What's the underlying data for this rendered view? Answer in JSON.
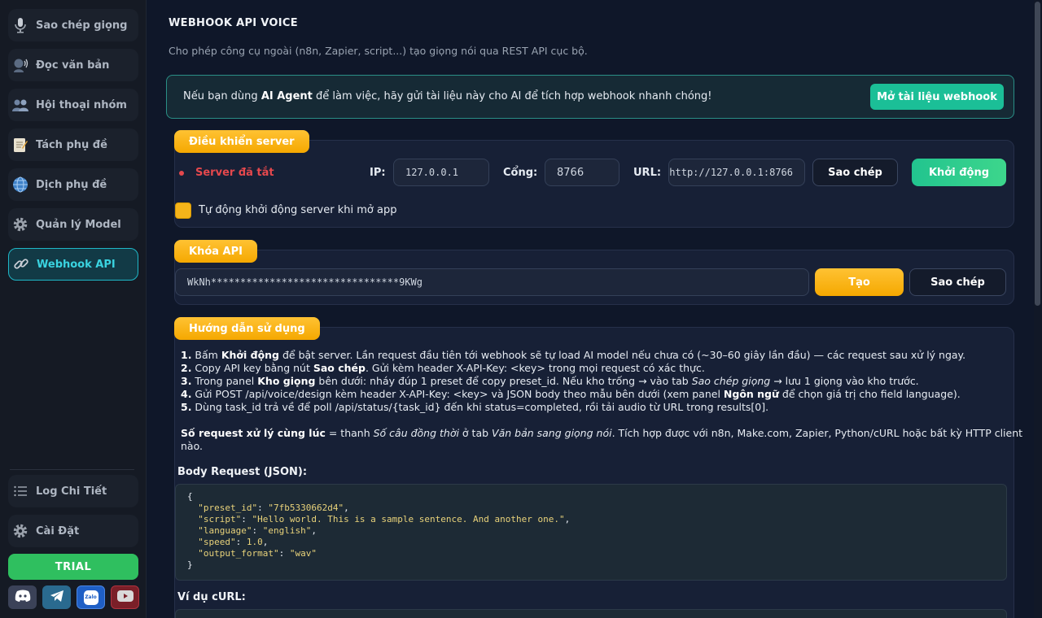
{
  "sidebar": {
    "items": [
      {
        "label": "Sao chép giọng",
        "icon": "microphone-icon"
      },
      {
        "label": "Đọc văn bản",
        "icon": "speaking-head-icon"
      },
      {
        "label": "Hội thoại nhóm",
        "icon": "people-icon"
      },
      {
        "label": "Tách phụ đề",
        "icon": "memo-icon"
      },
      {
        "label": "Dịch phụ đề",
        "icon": "globe-icon"
      },
      {
        "label": "Quản lý Model",
        "icon": "gear-icon"
      },
      {
        "label": "Webhook API",
        "icon": "link-icon",
        "active": true
      }
    ],
    "bottom": [
      {
        "label": "Log Chi Tiết",
        "icon": "list-icon"
      },
      {
        "label": "Cài Đặt",
        "icon": "gear-icon"
      }
    ],
    "trial_label": "TRIAL",
    "socials": [
      "discord-icon",
      "telegram-icon",
      "zalo-icon",
      "youtube-icon"
    ],
    "zalo_text": "Zalo"
  },
  "header": {
    "title": "WEBHOOK API VOICE",
    "subtitle": "Cho phép công cụ ngoài (n8n, Zapier, script...) tạo giọng nói qua REST API cục bộ."
  },
  "banner": {
    "text_pre": "Nếu bạn dùng ",
    "text_bold": "AI Agent",
    "text_post": " để làm việc, hãy gửi tài liệu này cho AI để tích hợp webhook nhanh chóng!",
    "button": "Mở tài liệu webhook"
  },
  "server": {
    "tag": "Điều khiển server",
    "status": "Server đã tắt",
    "ip_label": "IP:",
    "ip_value": "127.0.0.1",
    "port_label": "Cổng:",
    "port_value": "8766",
    "url_label": "URL:",
    "url_value": "http://127.0.0.1:8766",
    "copy_button": "Sao chép",
    "start_button": "Khởi động",
    "autostart_label": "Tự động khởi động server khi mở app"
  },
  "apikey": {
    "tag": "Khóa API",
    "value": "WkNh********************************9KWg",
    "generate_button": "Tạo",
    "copy_button": "Sao chép"
  },
  "guide": {
    "tag": "Hướng dẫn sử dụng",
    "steps": [
      {
        "num": "1.",
        "pre": " Bấm ",
        "bold": "Khởi động",
        "post": " để bật server. Lần request đầu tiên tới webhook sẽ tự load AI model nếu chưa có (~30–60 giây lần đầu) — các request sau xử lý ngay."
      },
      {
        "num": "2.",
        "pre": " Copy API key bằng nút ",
        "bold": "Sao chép",
        "post": ". Gửi kèm header X-API-Key: <key> trong mọi request có xác thực."
      },
      {
        "num": "3.",
        "pre": " Trong panel ",
        "bold": "Kho giọng",
        "mid": " bên dưới: nháy đúp 1 preset để copy preset_id. Nếu kho trống → vào tab ",
        "ital": "Sao chép giọng",
        "post": " → lưu 1 giọng vào kho trước."
      },
      {
        "num": "4.",
        "pre": " Gửi POST /api/voice/design kèm header X-API-Key: <key> và JSON body theo mẫu bên dưới (xem panel ",
        "bold": "Ngôn ngữ",
        "post": " để chọn giá trị cho field language)."
      },
      {
        "num": "5.",
        "pre": " Dùng task_id trả về để poll /api/status/{task_id} đến khi status=completed, rồi tải audio từ URL trong results[0].",
        "bold": "",
        "post": ""
      }
    ],
    "concurrency_bold": "Số request xử lý cùng lúc",
    "concurrency_mid1": " = thanh ",
    "concurrency_ital1": "Số câu đồng thời",
    "concurrency_mid2": " ở tab ",
    "concurrency_ital2": "Văn bản sang giọng nói",
    "concurrency_post": ". Tích hợp được với n8n, Make.com, Zapier, Python/cURL hoặc bất kỳ HTTP client",
    "concurrency_wrap": "nào.",
    "body_label": "Body Request (JSON):",
    "body_json": {
      "preset_id": "\"7fb5330662d4\"",
      "script": "\"Hello world. This is a sample sentence. And another one.\"",
      "language": "\"english\"",
      "speed": "1.0",
      "output_format": "\"wav\""
    },
    "curl_label": "Ví dụ cURL:"
  }
}
